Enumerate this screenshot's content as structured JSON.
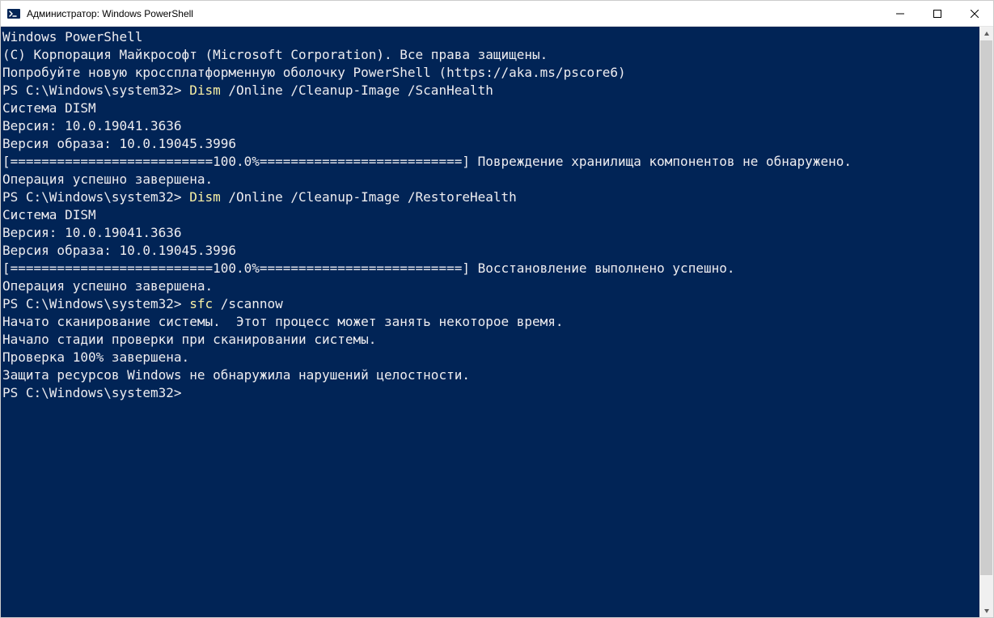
{
  "titlebar": {
    "title": "Администратор: Windows PowerShell"
  },
  "terminal": {
    "header1": "Windows PowerShell",
    "header2": "(C) Корпорация Майкрософт (Microsoft Corporation). Все права защищены.",
    "blank": "",
    "try_new": "Попробуйте новую кроссплатформенную оболочку PowerShell (https://aka.ms/pscore6)",
    "prompt1_pre": "PS C:\\Windows\\system32> ",
    "prompt1_cmd": "Dism",
    "prompt1_args": " /Online /Cleanup-Image /ScanHealth",
    "dism1_l1": "Cистема DISM",
    "dism1_l2": "Версия: 10.0.19041.3636",
    "dism1_l3": "Версия образа: 10.0.19045.3996",
    "dism1_progress": "[==========================100.0%==========================] Повреждение хранилища компонентов не обнаружено.",
    "dism1_done": "Операция успешно завершена.",
    "prompt2_pre": "PS C:\\Windows\\system32> ",
    "prompt2_cmd": "Dism",
    "prompt2_args": " /Online /Cleanup-Image /RestoreHealth",
    "dism2_l1": "Cистема DISM",
    "dism2_l2": "Версия: 10.0.19041.3636",
    "dism2_l3": "Версия образа: 10.0.19045.3996",
    "dism2_progress": "[==========================100.0%==========================] Восстановление выполнено успешно.",
    "dism2_done": "Операция успешно завершена.",
    "prompt3_pre": "PS C:\\Windows\\system32> ",
    "prompt3_cmd": "sfc",
    "prompt3_args": " /scannow",
    "sfc_l1": "Начато сканирование системы.  Этот процесс может занять некоторое время.",
    "sfc_l2": "Начало стадии проверки при сканировании системы.",
    "sfc_l3": "Проверка 100% завершена.",
    "sfc_l4": "Защита ресурсов Windows не обнаружила нарушений целостности.",
    "prompt4_pre": "PS C:\\Windows\\system32>"
  }
}
